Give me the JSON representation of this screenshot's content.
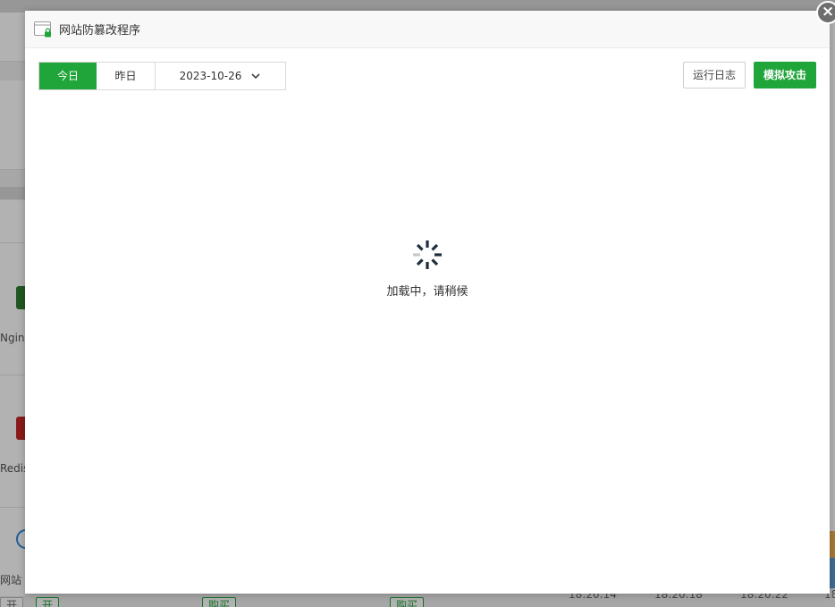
{
  "background": {
    "left_labels": [
      "Nginx",
      "Redis",
      "网站"
    ],
    "buttons": [
      "购买",
      "购买",
      "购买",
      "开",
      "开"
    ],
    "times": [
      "18:20:14",
      "18:20:18",
      "18:20:22",
      "18"
    ]
  },
  "modal": {
    "title": "网站防篡改程序",
    "close_icon": "close-icon"
  },
  "toolbar": {
    "tabs": [
      {
        "label": "今日",
        "active": true
      },
      {
        "label": "昨日",
        "active": false
      }
    ],
    "date_value": "2023-10-26",
    "log_button": "运行日志",
    "attack_button": "模拟攻击"
  },
  "loading": {
    "text": "加载中，请稍候"
  },
  "colors": {
    "accent": "#20a53a",
    "spinner": "#1f2d3d"
  }
}
